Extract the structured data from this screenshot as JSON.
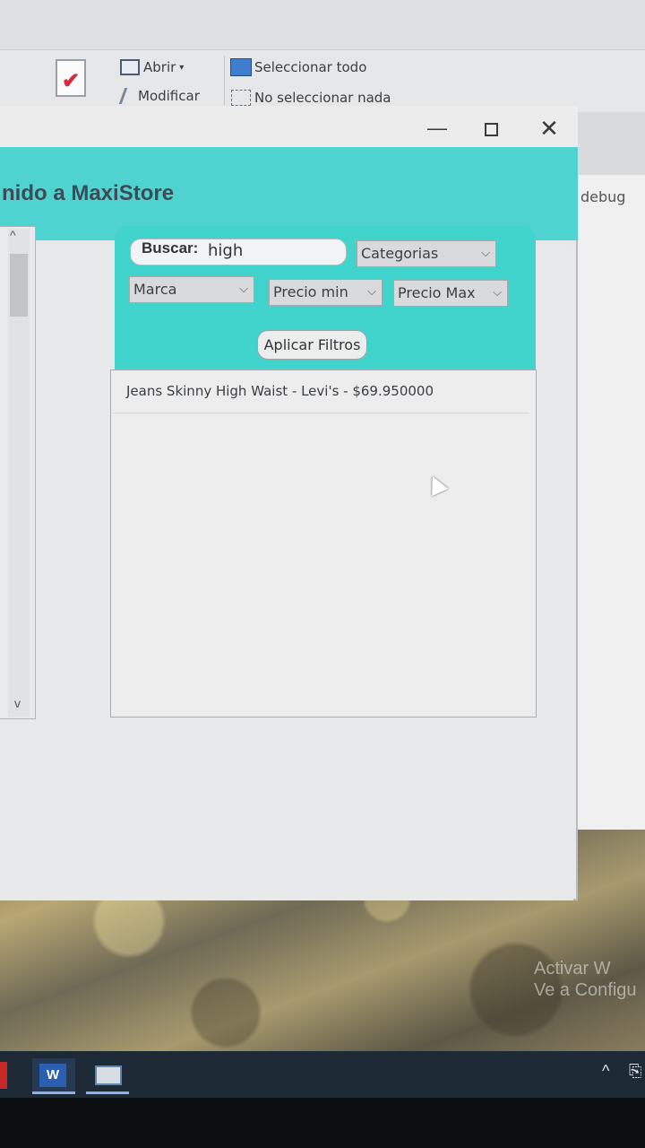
{
  "ribbon": {
    "open_label": "Abrir",
    "modify_label": "Modificar",
    "select_all_label": "Seleccionar todo",
    "select_none_label": "No seleccionar nada",
    "debug_label": "debug"
  },
  "window": {
    "welcome_title": "nido a MaxiStore"
  },
  "filters": {
    "search_label": "Buscar:",
    "search_value": "high",
    "categories_selected": "Categorias",
    "brand_selected": "Marca",
    "price_min_selected": "Precio min",
    "price_max_selected": "Precio Max",
    "apply_label": "Aplicar Filtros"
  },
  "results": {
    "items": [
      "Jeans Skinny High Waist - Levi's - $69.950000"
    ]
  },
  "desktop": {
    "activate_line1": "Activar W",
    "activate_line2": "Ve a Configu"
  },
  "taskbar": {
    "word_icon_text": "W"
  },
  "colors": {
    "accent": "#4fd3d0",
    "filter_panel": "#40d4cc"
  }
}
